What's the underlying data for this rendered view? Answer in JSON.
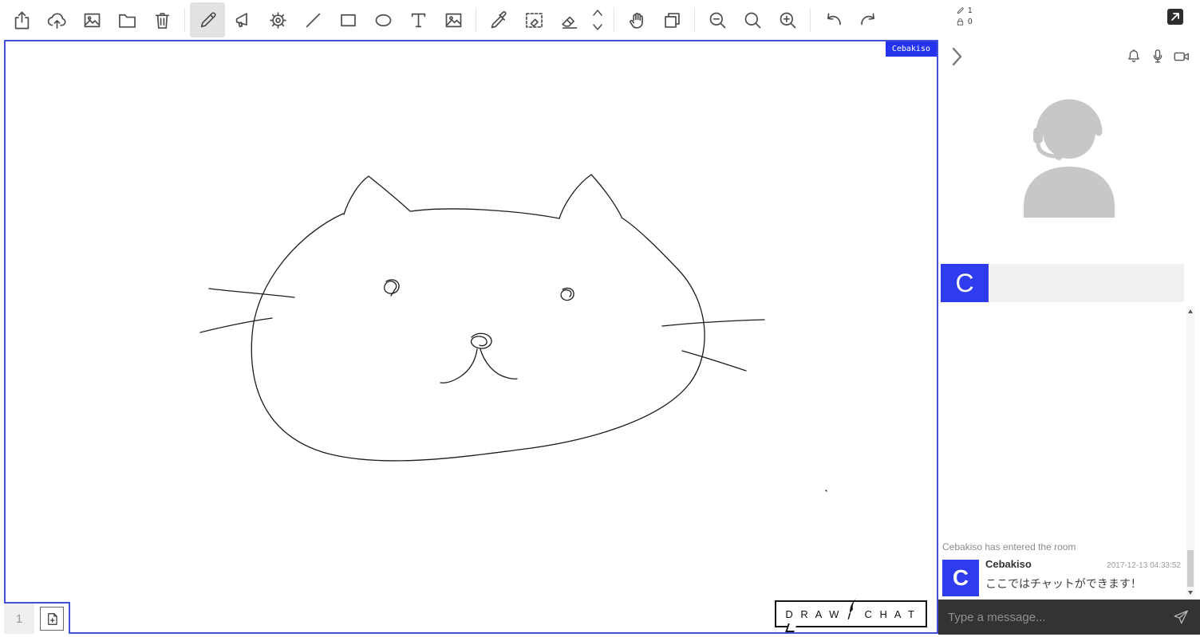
{
  "accent": "#2e3cee",
  "toolbar": {
    "selected_tool": "pencil",
    "tools": [
      "share",
      "cloud-upload",
      "save-image",
      "folder",
      "trash",
      "pencil",
      "marker",
      "gear",
      "line",
      "rectangle",
      "ellipse",
      "text",
      "image",
      "color-picker",
      "selection-eraser",
      "eraser",
      "size-up",
      "size-down",
      "hand",
      "pages",
      "zoom-out",
      "zoom-reset",
      "zoom-in",
      "undo",
      "redo",
      "fullscreen"
    ],
    "pen_count": "1",
    "lock_count": "0"
  },
  "canvas": {
    "cursor_label": "Cebakiso",
    "page_number": "1",
    "logo": {
      "left": "D R A W",
      "right": "C H A T"
    },
    "drawing": {
      "strokes": [
        "M423 216 C 370 240 314 300 309 368 C 303 444 334 498 404 517 C 474 535 567 522 644 512 C 735 501 824 473 858 428 C 885 392 884 327 840 283 C 816 258 791 233 772 221",
        "M508 213 C 556 206 642 212 694 222",
        "M424 217 C 430 198 442 178 455 169 C 470 181 492 199 507 213",
        "M694 222 C 701 201 717 179 734 167 C 747 181 763 202 772 220",
        "M477 301 C 486 296 494 301 493 308 C 492 316 481 319 476 313 C 472 307 478 299 485 301 C 490 303 491 308 488 311 L 483 319",
        "M698 311 C 706 307 713 311 712 318 C 711 325 701 327 697 321 C 694 316 699 310 705 312 C 709 313 710 317 707 320",
        "M584 371 C 591 364 603 365 608 372 C 612 379 604 386 595 385 C 586 384 580 377 586 372 C 592 368 602 370 603 376 C 604 380 599 383 594 381",
        "M591 386 C 589 400 582 413 569 421 C 561 426 552 429 545 428",
        "M595 386 C 599 399 607 411 619 418 C 627 422 636 424 641 423",
        "M255 310 C 288 314 330 317 362 321",
        "M244 365 C 272 358 305 351 334 347",
        "M823 357 C 862 353 913 350 951 349",
        "M848 388 C 876 396 904 405 928 413",
        "M1028 563 l1 1"
      ]
    }
  },
  "sidebar": {
    "user": {
      "initial": "C"
    },
    "chat": {
      "status": "Cebakiso has entered the room",
      "messages": [
        {
          "initial": "C",
          "author": "Cebakiso",
          "timestamp": "2017-12-13 04:33:52",
          "text": "ここではチャットができます！"
        }
      ]
    },
    "input": {
      "placeholder": "Type a message..."
    }
  }
}
